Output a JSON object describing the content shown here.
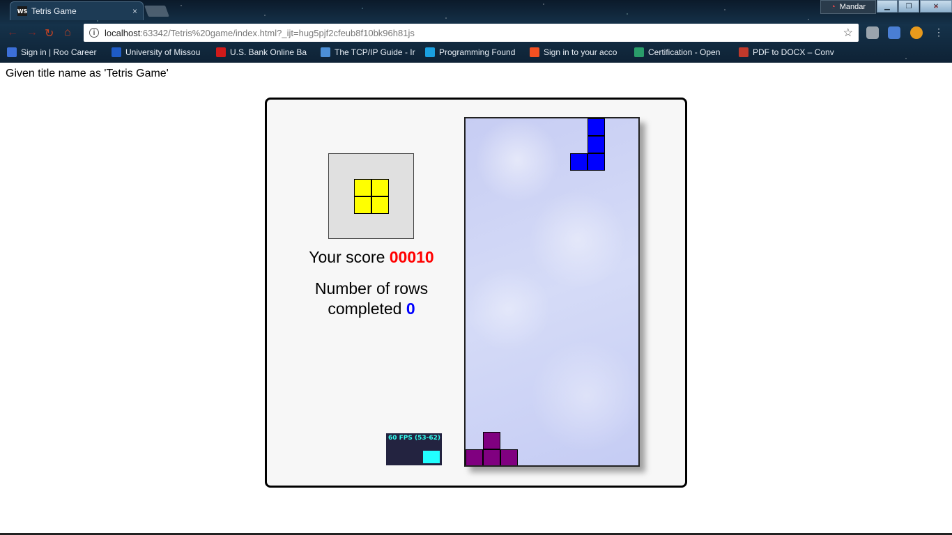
{
  "browser": {
    "tab_favicon_text": "WS",
    "tab_title": "Tetris Game",
    "tab_close": "×",
    "user_name": "Mandar",
    "url_host": "localhost",
    "url_rest": ":63342/Tetris%20game/index.html?_ijt=hug5pjf2cfeub8f10bk96h81js",
    "bookmarks": [
      {
        "label": "Sign in | Roo Career",
        "color": "#3c6fd8"
      },
      {
        "label": "University of Missou",
        "color": "#1e5bc6"
      },
      {
        "label": "U.S. Bank Online Ba",
        "color": "#d01a1a"
      },
      {
        "label": "The TCP/IP Guide - Ir",
        "color": "#4d8fd6"
      },
      {
        "label": "Programming Found",
        "color": "#1aa0e0"
      },
      {
        "label": "Sign in to your acco",
        "color": "#f25022"
      },
      {
        "label": "Certification - Open",
        "color": "#2a9d6a"
      },
      {
        "label": "PDF to DOCX – Conv",
        "color": "#c0392b"
      }
    ]
  },
  "page": {
    "caption": "Given title name as 'Tetris Game'"
  },
  "game": {
    "score_label": "Your score",
    "score_value": "00010",
    "rows_label_1": "Number of rows",
    "rows_label_2": "completed",
    "rows_value": "0",
    "fps_text": "60 FPS (53-62)",
    "colors": {
      "next_piece": "#ffff00",
      "active_piece": "#0000ff",
      "landed_piece": "#800080",
      "score": "#ff0000",
      "rows": "#0000ff"
    },
    "next_piece": {
      "shape": "O",
      "cells": [
        [
          0,
          0
        ],
        [
          1,
          0
        ],
        [
          0,
          1
        ],
        [
          1,
          1
        ]
      ]
    },
    "active_piece": {
      "shape": "J",
      "cells": [
        [
          7,
          0
        ],
        [
          7,
          1
        ],
        [
          6,
          2
        ],
        [
          7,
          2
        ]
      ]
    },
    "landed_cells": [
      [
        1,
        18
      ],
      [
        0,
        19
      ],
      [
        1,
        19
      ],
      [
        2,
        19
      ]
    ]
  }
}
